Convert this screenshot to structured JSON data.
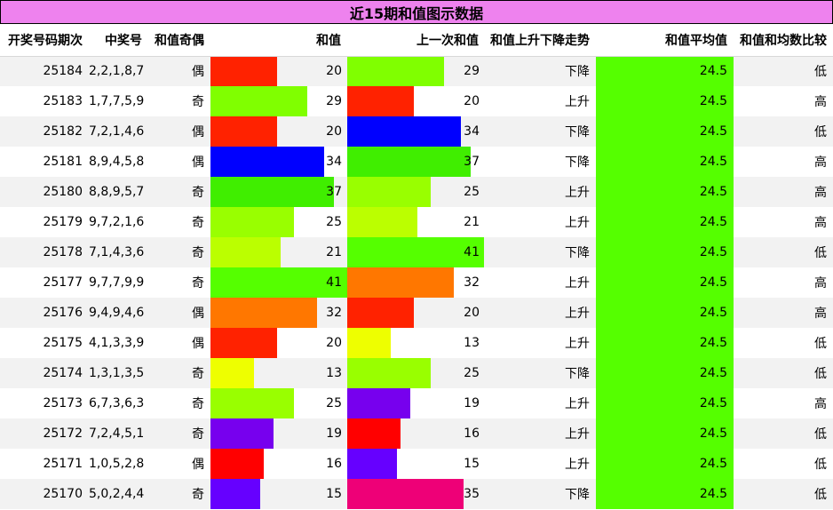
{
  "title": "近15期和值图示数据",
  "headers": {
    "period": "开奖号码期次",
    "numbers": "中奖号",
    "parity": "和值奇偶",
    "sum": "和值",
    "prev_sum": "上一次和值",
    "trend": "和值上升下降走势",
    "avg": "和值平均值",
    "compare": "和值和均数比较"
  },
  "scale_max": 41,
  "rows": [
    {
      "period": "25184",
      "numbers": "2,2,1,8,7",
      "parity": "偶",
      "sum": "20",
      "sum_color": "#ff2200",
      "prev": "29",
      "prev_color": "#80ff00",
      "trend": "下降",
      "avg": "24.5",
      "compare": "低"
    },
    {
      "period": "25183",
      "numbers": "1,7,7,5,9",
      "parity": "奇",
      "sum": "29",
      "sum_color": "#80ff00",
      "prev": "20",
      "prev_color": "#ff2200",
      "trend": "上升",
      "avg": "24.5",
      "compare": "高"
    },
    {
      "period": "25182",
      "numbers": "7,2,1,4,6",
      "parity": "偶",
      "sum": "20",
      "sum_color": "#ff2200",
      "prev": "34",
      "prev_color": "#0000ff",
      "trend": "下降",
      "avg": "24.5",
      "compare": "低"
    },
    {
      "period": "25181",
      "numbers": "8,9,4,5,8",
      "parity": "偶",
      "sum": "34",
      "sum_color": "#0000ff",
      "prev": "37",
      "prev_color": "#40ee00",
      "trend": "下降",
      "avg": "24.5",
      "compare": "高"
    },
    {
      "period": "25180",
      "numbers": "8,8,9,5,7",
      "parity": "奇",
      "sum": "37",
      "sum_color": "#40ee00",
      "prev": "25",
      "prev_color": "#99ff00",
      "trend": "上升",
      "avg": "24.5",
      "compare": "高"
    },
    {
      "period": "25179",
      "numbers": "9,7,2,1,6",
      "parity": "奇",
      "sum": "25",
      "sum_color": "#99ff00",
      "prev": "21",
      "prev_color": "#bbff00",
      "trend": "上升",
      "avg": "24.5",
      "compare": "高"
    },
    {
      "period": "25178",
      "numbers": "7,1,4,3,6",
      "parity": "奇",
      "sum": "21",
      "sum_color": "#bbff00",
      "prev": "41",
      "prev_color": "#55ff00",
      "trend": "下降",
      "avg": "24.5",
      "compare": "低"
    },
    {
      "period": "25177",
      "numbers": "9,7,7,9,9",
      "parity": "奇",
      "sum": "41",
      "sum_color": "#55ff00",
      "prev": "32",
      "prev_color": "#ff7700",
      "trend": "上升",
      "avg": "24.5",
      "compare": "高"
    },
    {
      "period": "25176",
      "numbers": "9,4,9,4,6",
      "parity": "偶",
      "sum": "32",
      "sum_color": "#ff7700",
      "prev": "20",
      "prev_color": "#ff2200",
      "trend": "上升",
      "avg": "24.5",
      "compare": "高"
    },
    {
      "period": "25175",
      "numbers": "4,1,3,3,9",
      "parity": "偶",
      "sum": "20",
      "sum_color": "#ff2200",
      "prev": "13",
      "prev_color": "#eeff00",
      "trend": "上升",
      "avg": "24.5",
      "compare": "低"
    },
    {
      "period": "25174",
      "numbers": "1,3,1,3,5",
      "parity": "奇",
      "sum": "13",
      "sum_color": "#eeff00",
      "prev": "25",
      "prev_color": "#99ff00",
      "trend": "下降",
      "avg": "24.5",
      "compare": "低"
    },
    {
      "period": "25173",
      "numbers": "6,7,3,6,3",
      "parity": "奇",
      "sum": "25",
      "sum_color": "#99ff00",
      "prev": "19",
      "prev_color": "#7700ee",
      "trend": "上升",
      "avg": "24.5",
      "compare": "高"
    },
    {
      "period": "25172",
      "numbers": "7,2,4,5,1",
      "parity": "奇",
      "sum": "19",
      "sum_color": "#7700ee",
      "prev": "16",
      "prev_color": "#ff0000",
      "trend": "上升",
      "avg": "24.5",
      "compare": "低"
    },
    {
      "period": "25171",
      "numbers": "1,0,5,2,8",
      "parity": "偶",
      "sum": "16",
      "sum_color": "#ff0000",
      "prev": "15",
      "prev_color": "#6600ff",
      "trend": "上升",
      "avg": "24.5",
      "compare": "低"
    },
    {
      "period": "25170",
      "numbers": "5,0,2,4,4",
      "parity": "奇",
      "sum": "15",
      "sum_color": "#6600ff",
      "prev": "35",
      "prev_color": "#ee0077",
      "trend": "下降",
      "avg": "24.5",
      "compare": "低"
    }
  ]
}
